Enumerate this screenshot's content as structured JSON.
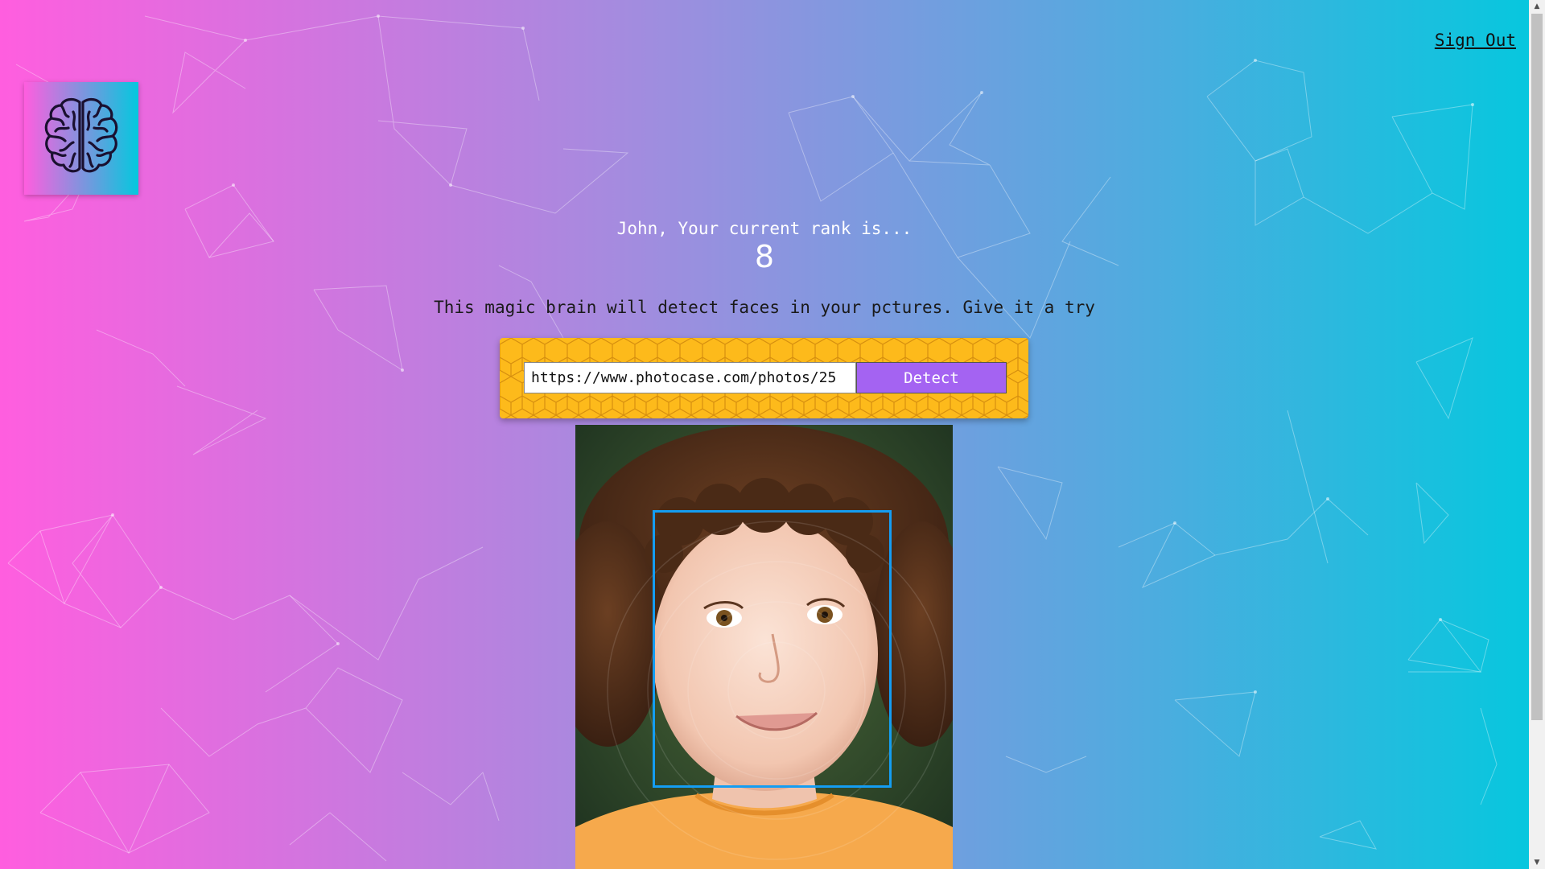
{
  "header": {
    "sign_out_label": "Sign Out"
  },
  "logo": {
    "icon": "brain-icon"
  },
  "rank": {
    "message": "John, Your current rank is...",
    "value": "8"
  },
  "intro_text": "This magic brain will detect faces in your pctures. Give it a try",
  "form": {
    "url_value": "https://www.photocase.com/photos/25",
    "detect_label": "Detect"
  },
  "result": {
    "image": "child-portrait",
    "face_box_color": "#149df2"
  },
  "colors": {
    "gradient_left": "#ff5edf",
    "gradient_right": "#04c8de",
    "form_bg": "#fdba1b",
    "button_bg": "#a463f2"
  },
  "scrollbar": {
    "up_icon": "arrow-up-icon",
    "down_icon": "arrow-down-icon"
  }
}
